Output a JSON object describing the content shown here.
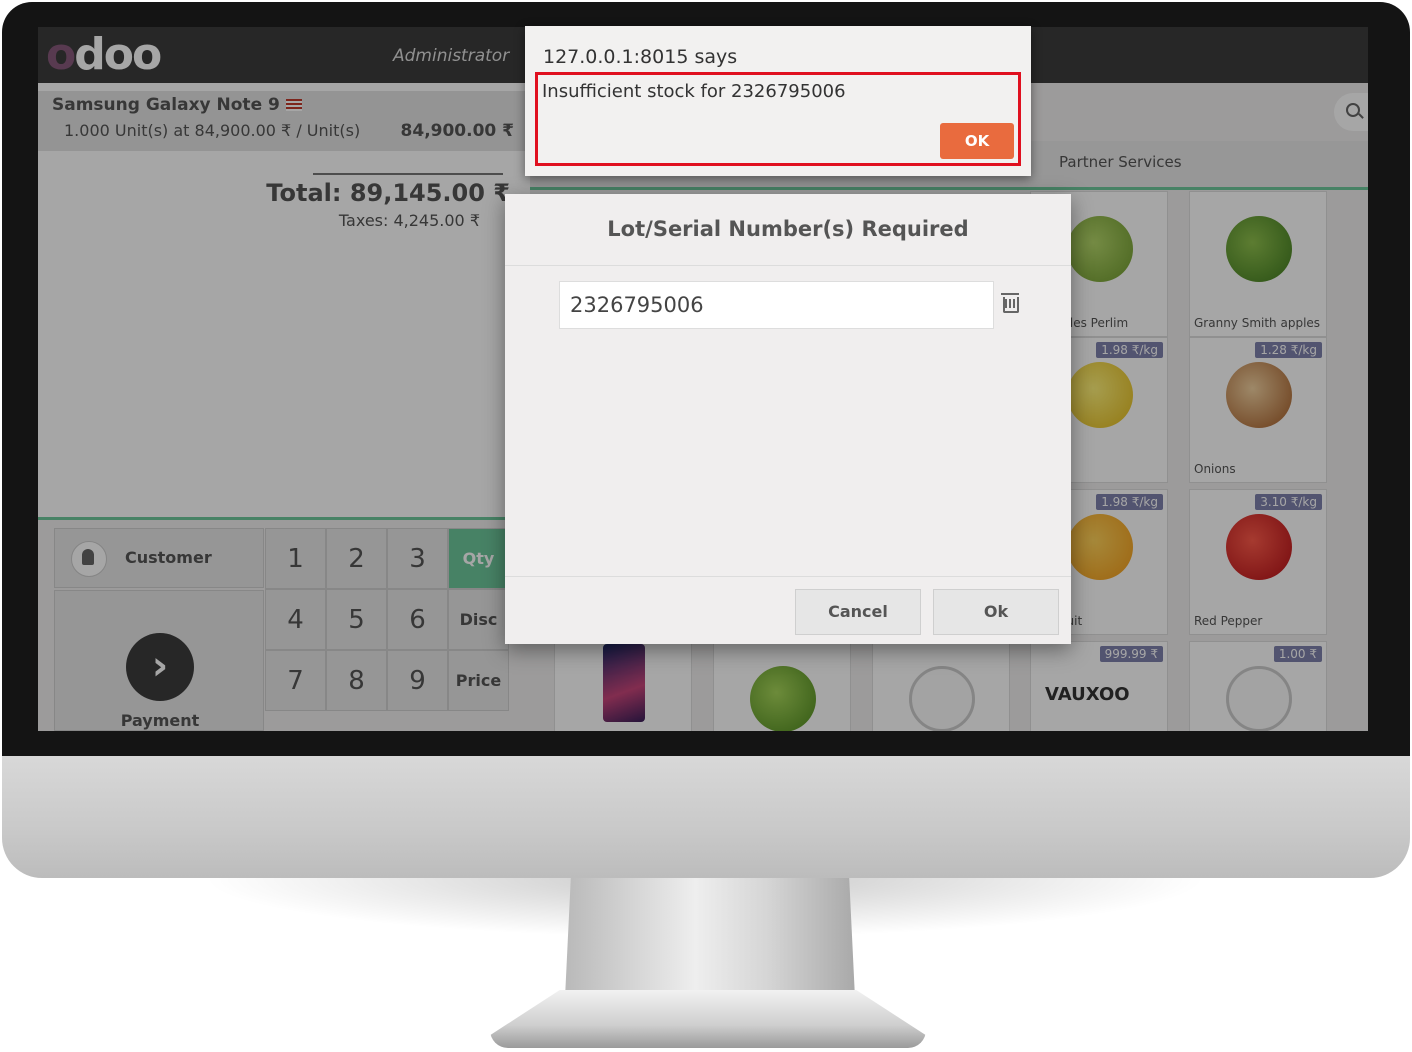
{
  "topbar": {
    "logo": "odoo",
    "user": "Administrator"
  },
  "order": {
    "line_name": "Samsung Galaxy Note 9",
    "line_detail": "1.000 Unit(s) at 84,900.00 ₹ / Unit(s)",
    "line_price": "84,900.00 ₹",
    "total": "Total: 89,145.00 ₹",
    "taxes": "Taxes: 4,245.00 ₹"
  },
  "controls": {
    "customer": "Customer",
    "payment": "Payment",
    "keys": [
      "1",
      "2",
      "3",
      "4",
      "5",
      "6",
      "7",
      "8",
      "9"
    ],
    "modes": [
      "Qty",
      "Disc",
      "Price"
    ]
  },
  "products": {
    "category": "Partner Services",
    "items": [
      {
        "name": "n Apples Perlim",
        "price": ""
      },
      {
        "name": "Granny Smith apples",
        "price": ""
      },
      {
        "name": "",
        "price": "1.98 ₹/kg"
      },
      {
        "name": "Onions",
        "price": "1.28 ₹/kg"
      },
      {
        "name": "apefruit",
        "price": "1.98 ₹/kg"
      },
      {
        "name": "Red Pepper",
        "price": "3.10 ₹/kg"
      },
      {
        "name": "",
        "price": "999.99 ₹"
      },
      {
        "name": "",
        "price": "1.00 ₹"
      }
    ],
    "vauxoo": "VAUXOO"
  },
  "lot_dialog": {
    "title": "Lot/Serial Number(s) Required",
    "lot_value": "2326795006",
    "cancel": "Cancel",
    "ok": "Ok"
  },
  "alert": {
    "title": "127.0.0.1:8015 says",
    "message": "Insufficient stock for 2326795006",
    "ok": "OK"
  },
  "colors": {
    "accent": "#6ec89b",
    "brand": "#875a7b",
    "alert_ok": "#e96b3e",
    "highlight": "#e0101f"
  }
}
